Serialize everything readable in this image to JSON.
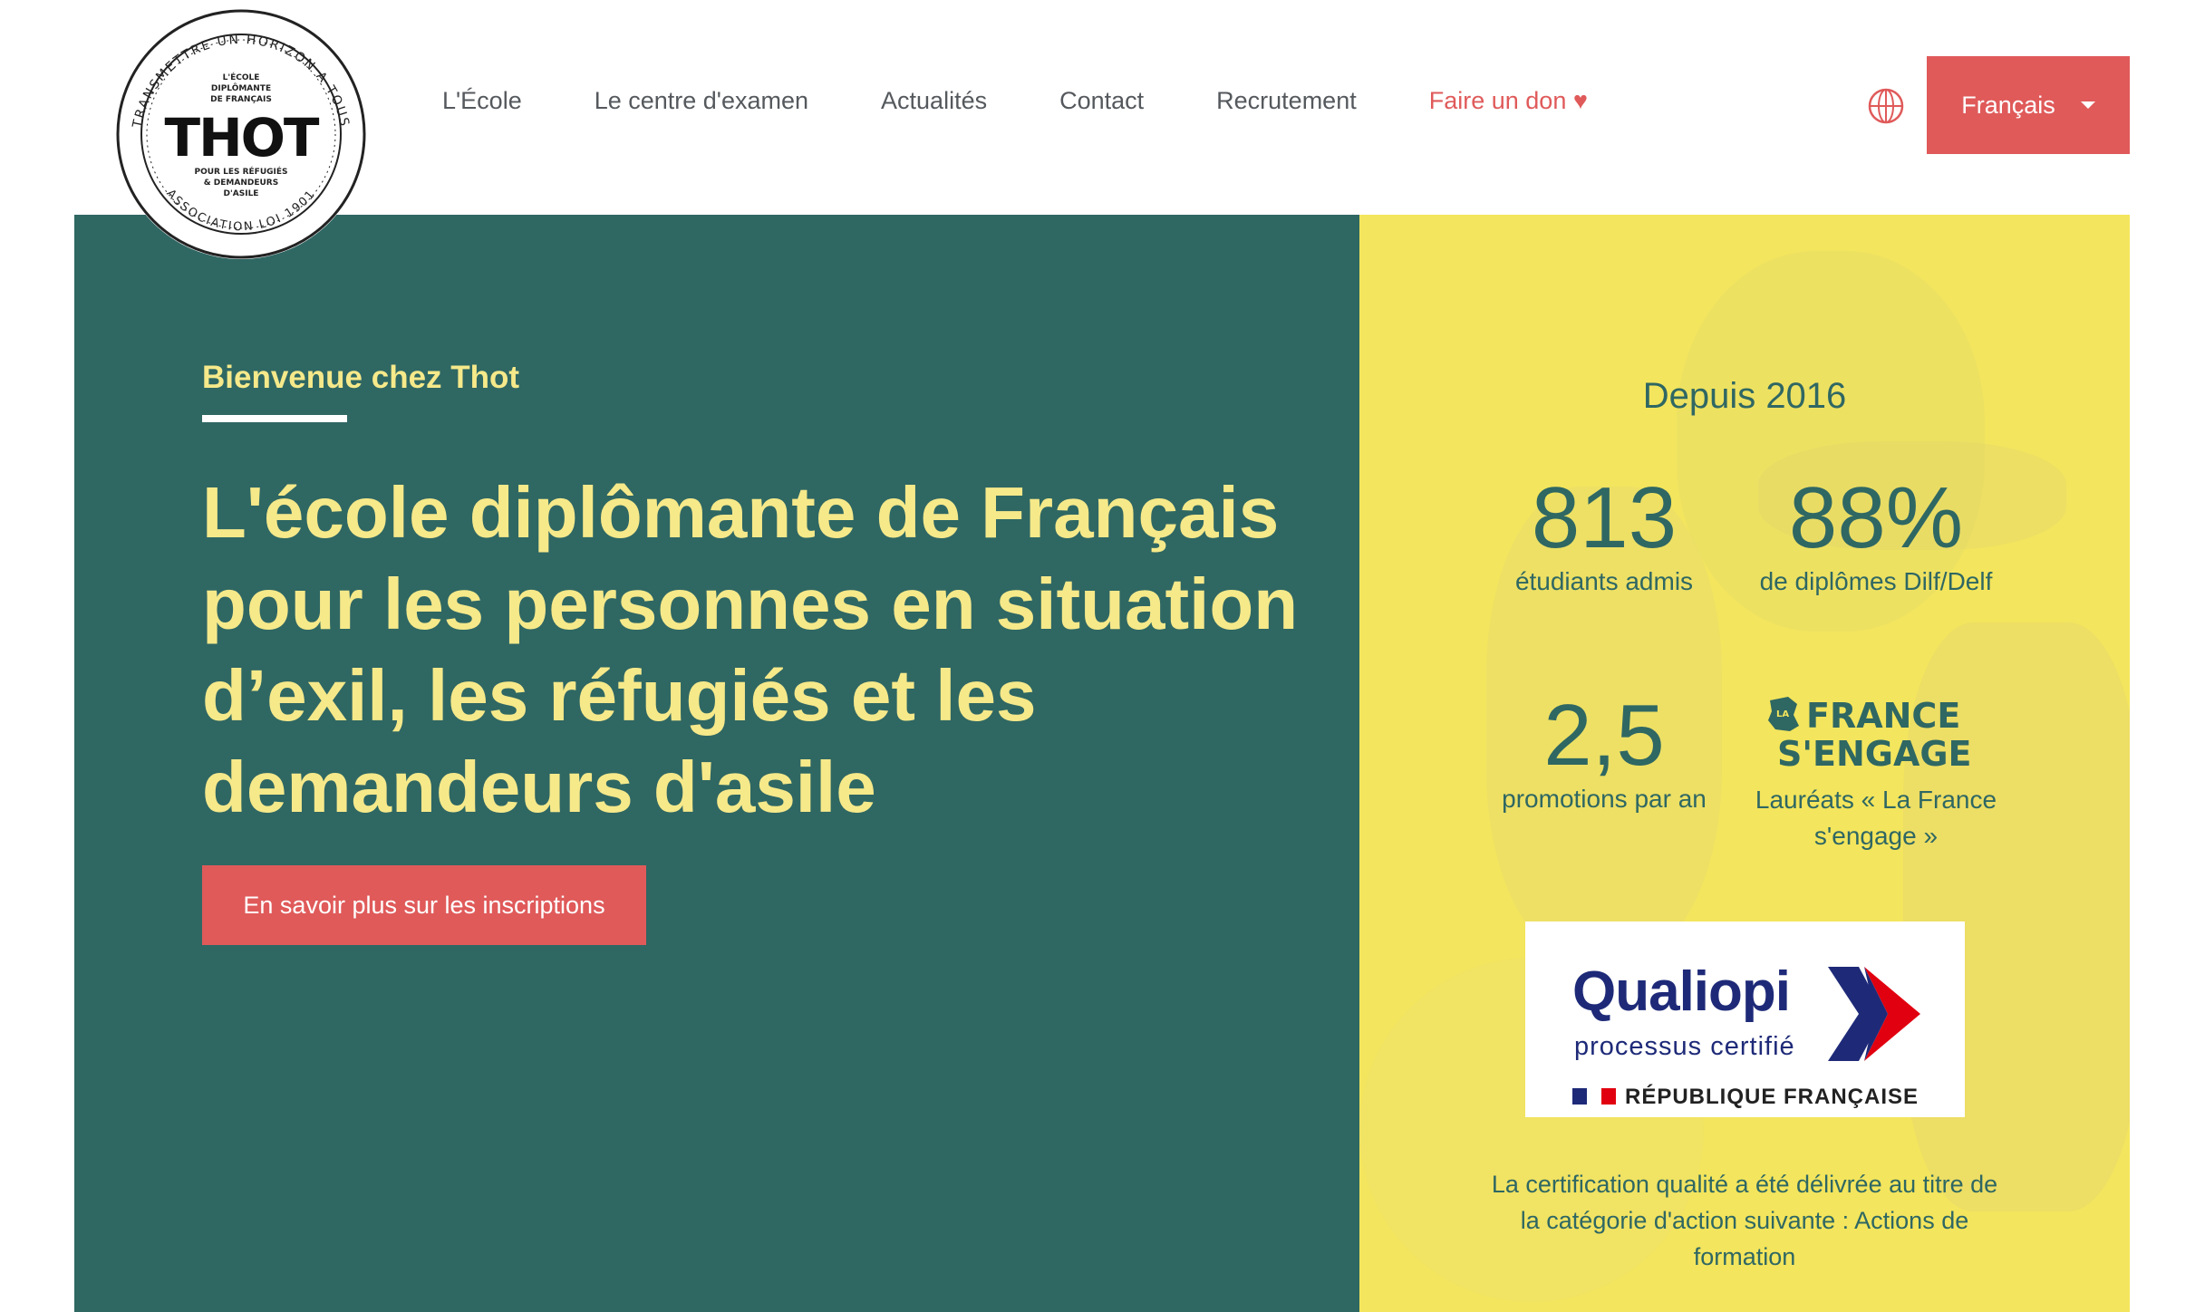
{
  "logo": {
    "arc_top": "TRANSMETTRE UN HORIZON A TOUS",
    "arc_bottom": "ASSOCIATION LOI 1901",
    "tagline_top": [
      "L'ÉCOLE",
      "DIPLÔMANTE",
      "DE FRANÇAIS"
    ],
    "wordmark": "THOT",
    "tagline_bottom": [
      "POUR LES RÉFUGIÉS",
      "& DEMANDEURS",
      "D'ASILE"
    ]
  },
  "nav": {
    "items": [
      {
        "label": "L'École"
      },
      {
        "label": "Le centre d'examen"
      },
      {
        "label": "Actualités"
      },
      {
        "label": "Contact"
      },
      {
        "label": "Recrutement"
      }
    ],
    "donate": "Faire un don ♥",
    "globe_icon": "globe-icon",
    "language": "Français"
  },
  "colors": {
    "teal": "#2f6763",
    "yellow": "#f3e55d",
    "headline_yellow": "#f6e98a",
    "accent_red": "#e05a5a"
  },
  "hero": {
    "welcome": "Bienvenue chez Thot",
    "headline": "L'école diplômante de Français pour les personnes en situation d’exil, les réfugiés et les demandeurs d'asile",
    "cta": "En savoir plus sur les inscriptions"
  },
  "stats": {
    "since": "Depuis 2016",
    "items": [
      {
        "value": "813",
        "label": "étudiants admis"
      },
      {
        "value": "88%",
        "label": "de diplômes Dilf/Delf"
      },
      {
        "value": "2,5",
        "label": "promotions par an"
      },
      {
        "logo_text": [
          "FRANCE",
          "S'ENGAGE"
        ],
        "logo_small": "LA",
        "label": "Lauréats « La France s'engage »"
      }
    ]
  },
  "qualiopi": {
    "wordmark": "Qualiopi",
    "subtitle": "processus certifié",
    "republic": "RÉPUBLIQUE FRANÇAISE",
    "certification_text": "La certification qualité a été délivrée au titre de la catégorie d'action suivante : Actions de formation"
  }
}
